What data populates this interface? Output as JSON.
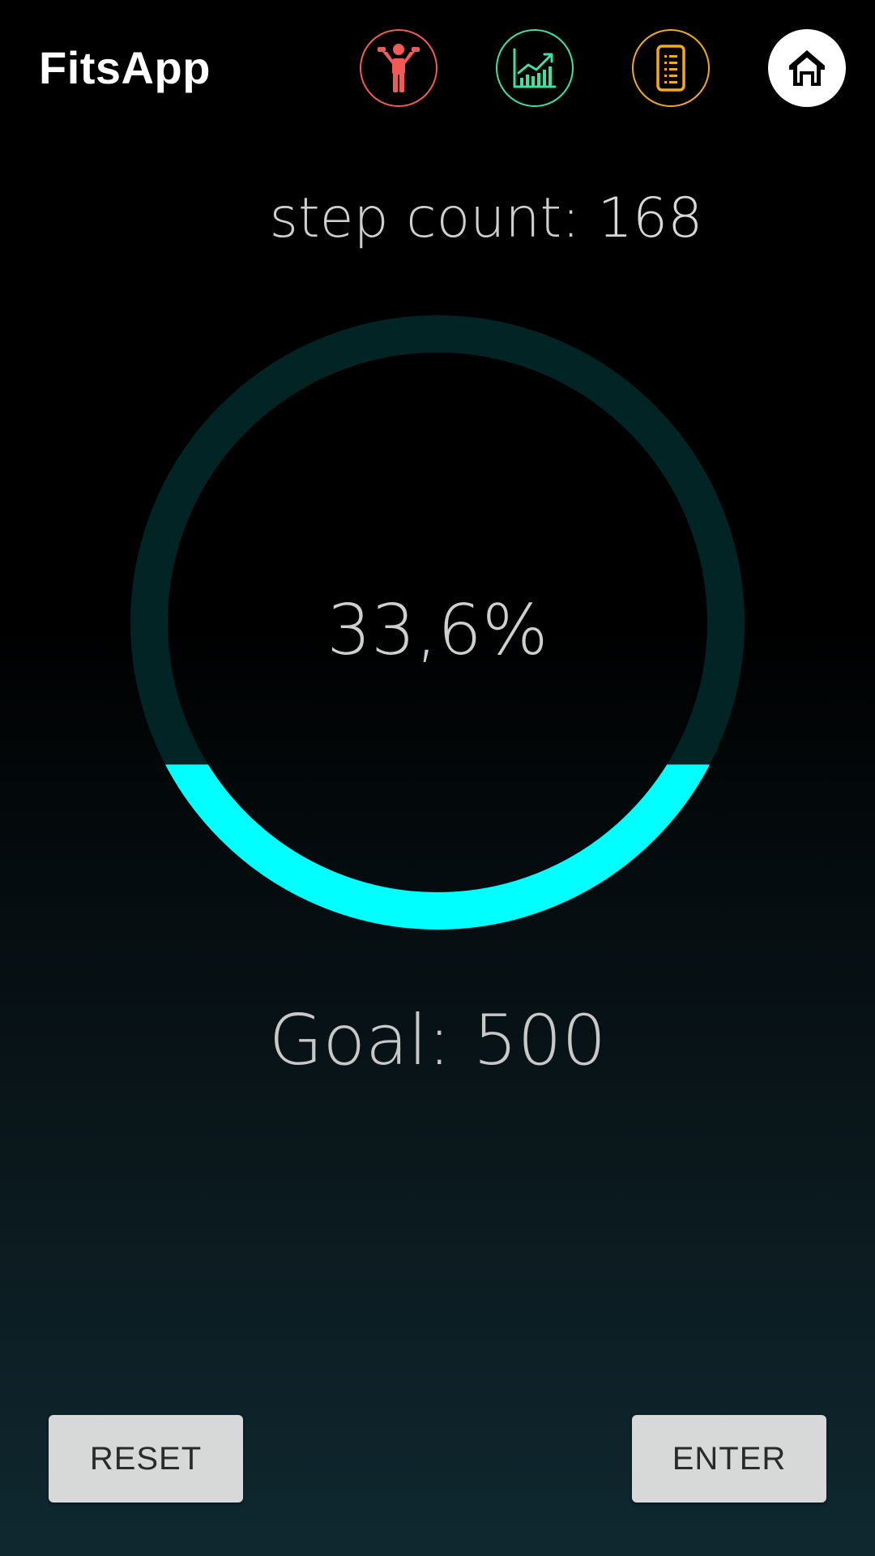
{
  "app": {
    "title": "FitsApp"
  },
  "nav": [
    {
      "name": "workout",
      "icon": "person-dumbbell-icon",
      "color": "#f25a55"
    },
    {
      "name": "stats",
      "icon": "chart-icon",
      "color": "#3fe0a2"
    },
    {
      "name": "list",
      "icon": "list-icon",
      "color": "#f2a922"
    },
    {
      "name": "home",
      "icon": "home-icon",
      "color": "#000000"
    }
  ],
  "steps": {
    "label": "step count:",
    "value": "168"
  },
  "progress": {
    "percent_text": "33,6%",
    "fraction": 0.336,
    "fill_color": "#00ffff",
    "track_color": "#022424"
  },
  "goal": {
    "text": "Goal: 500"
  },
  "buttons": {
    "reset_label": "RESET",
    "enter_label": "ENTER"
  }
}
